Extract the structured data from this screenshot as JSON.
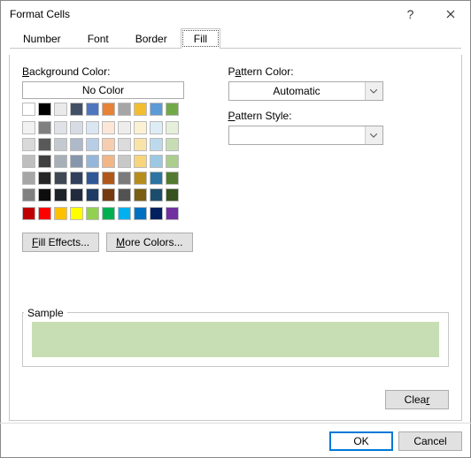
{
  "title": "Format Cells",
  "tabs": [
    "Number",
    "Font",
    "Border",
    "Fill"
  ],
  "active_tab": "Fill",
  "labels": {
    "bg": "Background Color:",
    "nocolor": "No Color",
    "pattern_color": "Pattern Color:",
    "pattern_style": "Pattern Style:",
    "sample": "Sample"
  },
  "dropdowns": {
    "pattern_color": "Automatic",
    "pattern_style": ""
  },
  "buttons": {
    "fill_effects": "Fill Effects...",
    "more_colors": "More Colors...",
    "clear": "Clear",
    "ok": "OK",
    "cancel": "Cancel"
  },
  "selected_color": "#c7deb4",
  "palette_top": [
    [
      "#ffffff",
      "#000000",
      "#eaeaea",
      "#425066",
      "#4d76bf",
      "#e78236",
      "#a6a6a6",
      "#f2bd2e",
      "#5c9bd6",
      "#71a948"
    ]
  ],
  "palette_main": [
    [
      "#f2f2f2",
      "#808080",
      "#e0e2e8",
      "#d6dbe4",
      "#dbe6f3",
      "#fbe6d7",
      "#ededed",
      "#fcf1d3",
      "#deecf6",
      "#e4f0da"
    ],
    [
      "#d9d9d9",
      "#595959",
      "#c4c9d0",
      "#aeb9c9",
      "#b8cee7",
      "#f7cdaf",
      "#dbdbdb",
      "#f9e3a8",
      "#bddaed",
      "#c7deb4"
    ],
    [
      "#bfbfbf",
      "#404040",
      "#a7afb9",
      "#8596ad",
      "#94b6db",
      "#f3b486",
      "#c8c8c8",
      "#f7d57c",
      "#9cc8e4",
      "#abce8f"
    ],
    [
      "#a6a6a6",
      "#262626",
      "#3f4854",
      "#31405b",
      "#2f5897",
      "#b15818",
      "#7b7b7b",
      "#b68d1c",
      "#2c74a3",
      "#527a2f"
    ],
    [
      "#808080",
      "#0d0d0d",
      "#1d222a",
      "#212b3d",
      "#1e3b65",
      "#763a10",
      "#525252",
      "#795e13",
      "#1d4d6d",
      "#36521f"
    ]
  ],
  "palette_std": [
    [
      "#c00000",
      "#ff0000",
      "#ffc000",
      "#ffff00",
      "#92d050",
      "#00b050",
      "#00b0f0",
      "#0070c0",
      "#002060",
      "#7030a0"
    ]
  ]
}
